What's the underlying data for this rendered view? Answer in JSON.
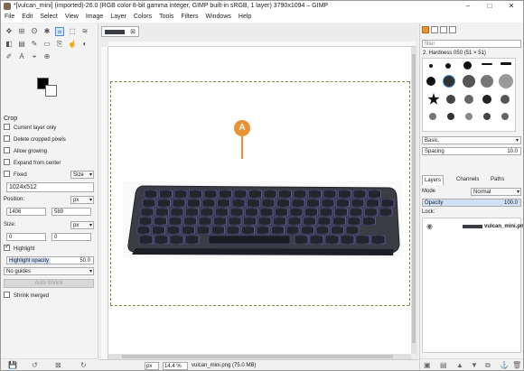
{
  "window": {
    "title": "*[vulcan_mini] (imported)-26.0 (RGB color 8-bit gamma integer, GIMP built-in sRGB, 1 layer) 3790x1094 – GIMP",
    "minimize": "–",
    "maximize": "□",
    "close": "✕"
  },
  "menu": [
    "File",
    "Edit",
    "Select",
    "View",
    "Image",
    "Layer",
    "Colors",
    "Tools",
    "Filters",
    "Windows",
    "Help"
  ],
  "tool_options": {
    "title": "Crop",
    "current_layer_only": "Current layer only",
    "delete_cropped_pixels": "Delete cropped pixels",
    "allow_growing": "Allow growing",
    "expand_from_center": "Expand from center",
    "fixed_label": "Fixed",
    "fixed_mode": "Size",
    "size_value": "1024x512",
    "position_label": "Position:",
    "position_unit": "px",
    "pos_x": "1406",
    "pos_y": "589",
    "size_label": "Size:",
    "size_unit": "px",
    "size_w": "0",
    "size_h": "0",
    "highlight": "Highlight",
    "highlight_opacity_label": "Highlight opacity",
    "highlight_opacity_value": "50.0",
    "guides": "No guides",
    "auto_shrink": "Auto Shrink",
    "shrink_merged": "Shrink merged"
  },
  "canvas": {
    "callout": "A",
    "status_unit": "px",
    "zoom": "14.4 %",
    "status_text": "vulcan_mini.png (75.0 MB)"
  },
  "brushes": {
    "filter_placeholder": "filter",
    "selected_brush": "2. Hardness 050 (51 × 51)",
    "preset": "Basic.",
    "spacing_label": "Spacing",
    "spacing_value": "10.0"
  },
  "layers": {
    "tabs": [
      "Layers",
      "Channels",
      "Paths"
    ],
    "mode_label": "Mode",
    "mode_value": "Normal",
    "opacity_label": "Opacity",
    "opacity_value": "100.0",
    "lock_label": "Lock:",
    "layer_name": "vulcan_mini.png"
  },
  "colors": {
    "accent": "#e8932f",
    "keyboard_body": "#3a3d44",
    "key_glow": "#7a5cc8"
  }
}
